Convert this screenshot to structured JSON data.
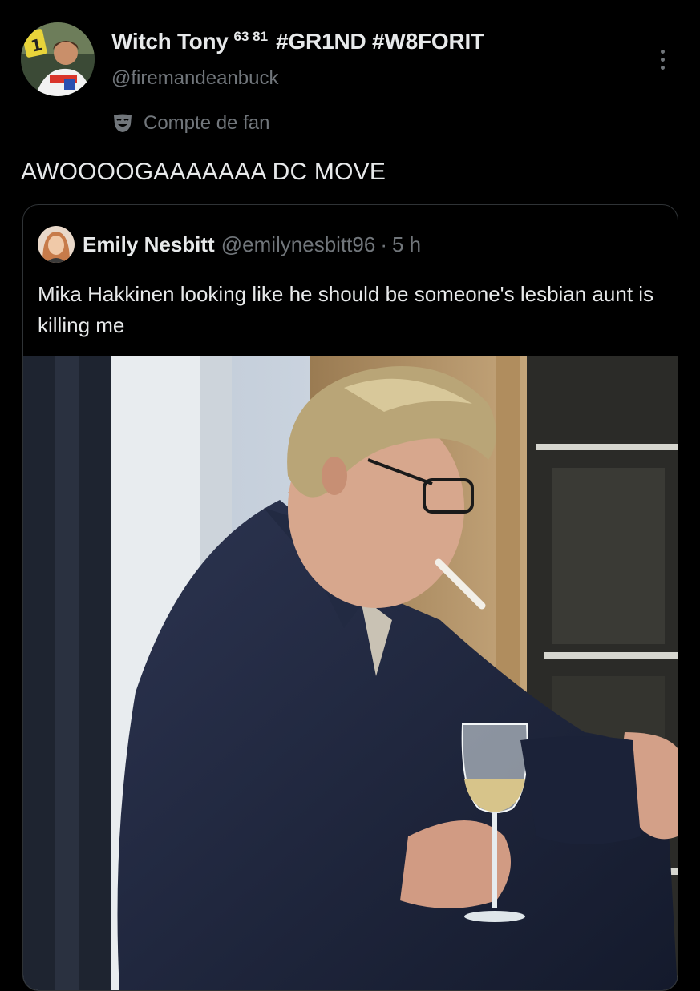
{
  "post": {
    "display_name": "Witch Tony",
    "superscript": "63 81",
    "hashtags": "#GR1ND #W8FORIT",
    "handle": "@firemandeanbuck",
    "account_label": "Compte de fan",
    "account_label_icon": "theater-mask-icon",
    "text": "AWOOOOGAAAAAAA DC MOVE",
    "more_icon": "more-options-icon"
  },
  "quote": {
    "display_name": "Emily Nesbitt",
    "handle": "@emilynesbitt96",
    "separator": "·",
    "time": "5 h",
    "text": "Mika Hakkinen looking like he should be someone's lesbian aunt is killing me"
  },
  "colors": {
    "background": "#000000",
    "primary_text": "#e7e9ea",
    "secondary_text": "#71767b",
    "border": "#2f3336"
  }
}
